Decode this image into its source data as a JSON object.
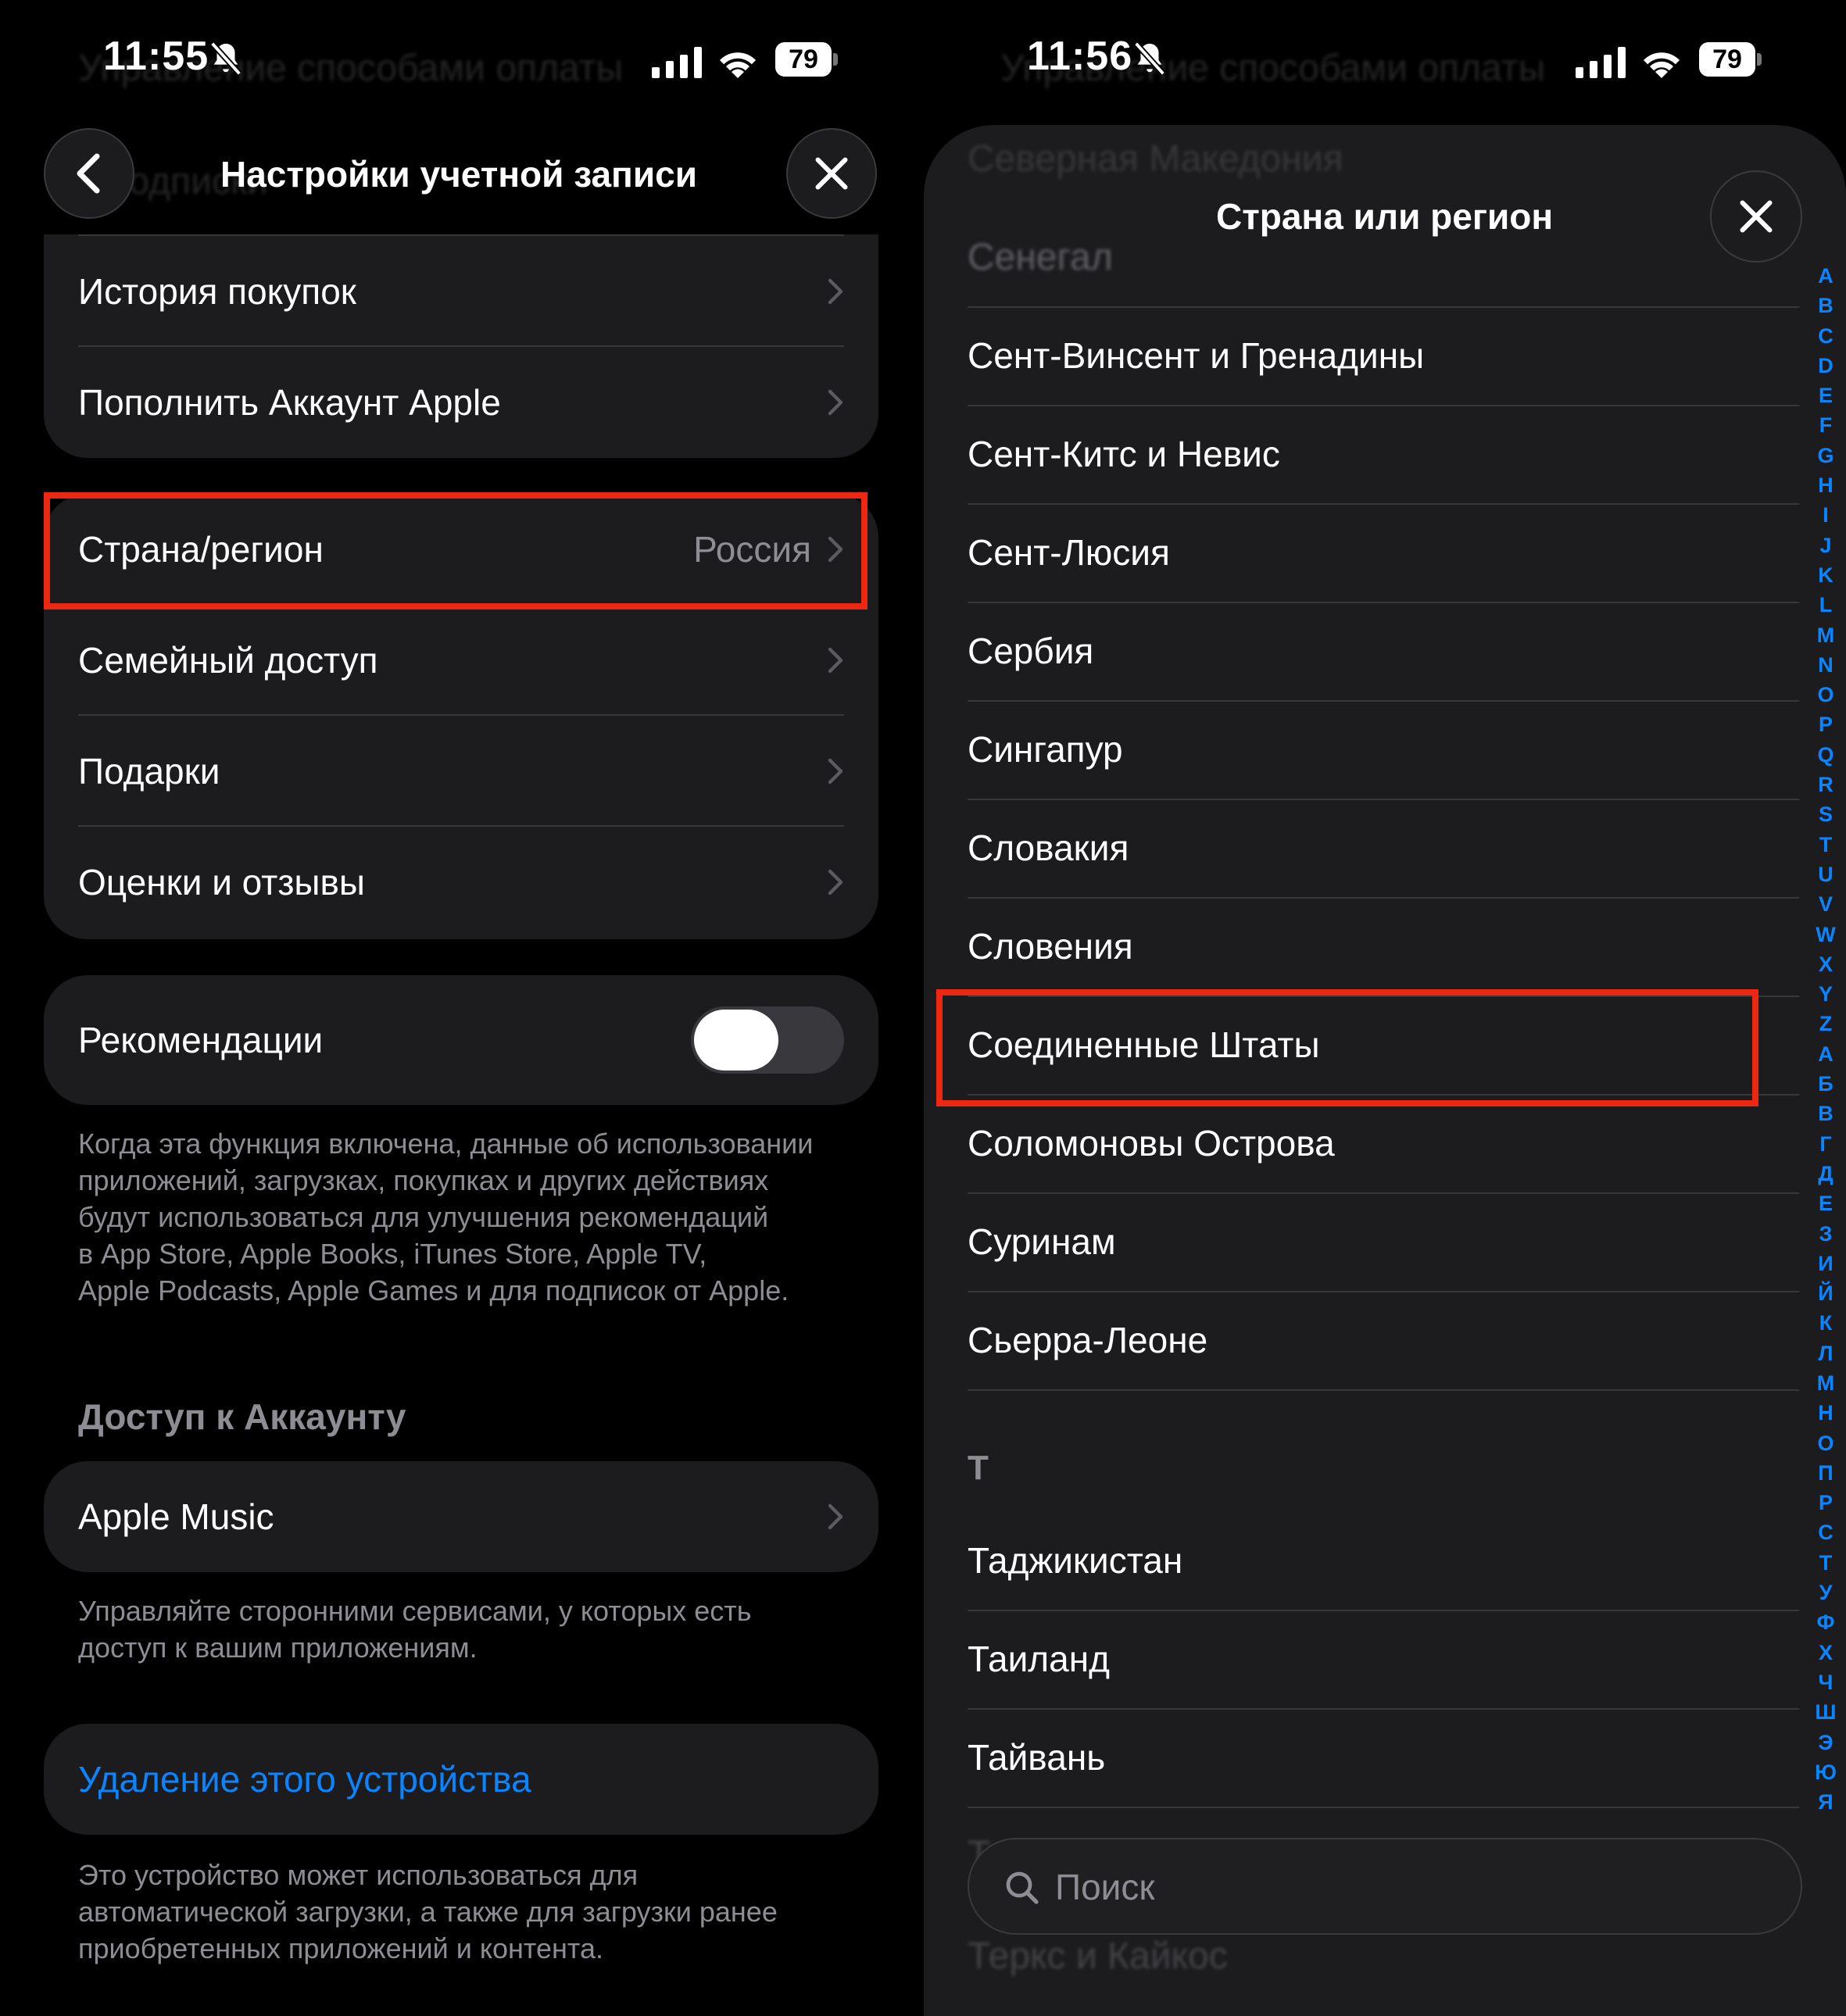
{
  "left": {
    "status": {
      "time": "11:55",
      "battery": "79"
    },
    "ghost_behind_header": [
      "Управление способами оплаты",
      "Подписки"
    ],
    "header": {
      "title": "Настройки учетной записи"
    },
    "group1": [
      {
        "label": "История покупок"
      },
      {
        "label": "Пополнить Аккаунт Apple"
      }
    ],
    "group2": [
      {
        "label": "Страна/регион",
        "value": "Россия"
      },
      {
        "label": "Семейный доступ"
      },
      {
        "label": "Подарки"
      },
      {
        "label": "Оценки и отзывы"
      }
    ],
    "recommendations": {
      "label": "Рекомендации",
      "enabled": true,
      "footnote": [
        "Когда эта функция включена, данные об использовании",
        "приложений, загрузках, покупках и других действиях",
        "будут использоваться для улучшения рекомендаций",
        "в App Store, Apple Books, iTunes Store, Apple TV,",
        "Apple Podcasts, Apple Games и для подписок от Apple."
      ]
    },
    "account_access": {
      "header": "Доступ к Аккаунту",
      "item": "Apple Music",
      "footnote": [
        "Управляйте сторонними сервисами, у которых есть",
        "доступ к вашим приложениям."
      ]
    },
    "remove_device": {
      "label": "Удаление этого устройства",
      "footnote": [
        "Это устройство может использоваться для",
        "автоматической загрузки, а также для загрузки ранее",
        "приобретенных приложений и контента."
      ]
    }
  },
  "right": {
    "status": {
      "time": "11:56",
      "battery": "79"
    },
    "ghost_behind_header": [
      "Управление способами оплаты",
      "Северная Македония"
    ],
    "header": {
      "title": "Страна или регион"
    },
    "ghost_top_row": "Сенегал",
    "countries_s": [
      "Сент-Винсент и Гренадины",
      "Сент-Китс и Невис",
      "Сент-Люсия",
      "Сербия",
      "Сингапур",
      "Словакия",
      "Словения",
      "Соединенные Штаты",
      "Соломоновы Острова",
      "Суринам",
      "Сьерра-Леоне"
    ],
    "section_t": "Т",
    "countries_t": [
      "Таджикистан",
      "Таиланд",
      "Тайвань"
    ],
    "ghost_bottom_rows": [
      "Танзания",
      "Теркс и Кайкос"
    ],
    "index_letters": [
      "A",
      "B",
      "C",
      "D",
      "E",
      "F",
      "G",
      "H",
      "I",
      "J",
      "K",
      "L",
      "M",
      "N",
      "O",
      "P",
      "Q",
      "R",
      "S",
      "T",
      "U",
      "V",
      "W",
      "X",
      "Y",
      "Z",
      "А",
      "Б",
      "В",
      "Г",
      "Д",
      "Е",
      "З",
      "И",
      "Й",
      "К",
      "Л",
      "М",
      "Н",
      "О",
      "П",
      "Р",
      "С",
      "Т",
      "У",
      "Ф",
      "Х",
      "Ч",
      "Ш",
      "Э",
      "Ю",
      "Я"
    ],
    "search": {
      "placeholder": "Поиск"
    }
  },
  "colors": {
    "highlight": "#ee2712",
    "link": "#0a84ff",
    "card": "#1c1c1e",
    "secondary_text": "#8d8d93"
  },
  "icons": [
    "bell-slash-icon",
    "cellular-signal-icon",
    "wifi-icon",
    "battery-icon",
    "chevron-left-icon",
    "close-icon",
    "chevron-right-icon",
    "search-icon"
  ]
}
